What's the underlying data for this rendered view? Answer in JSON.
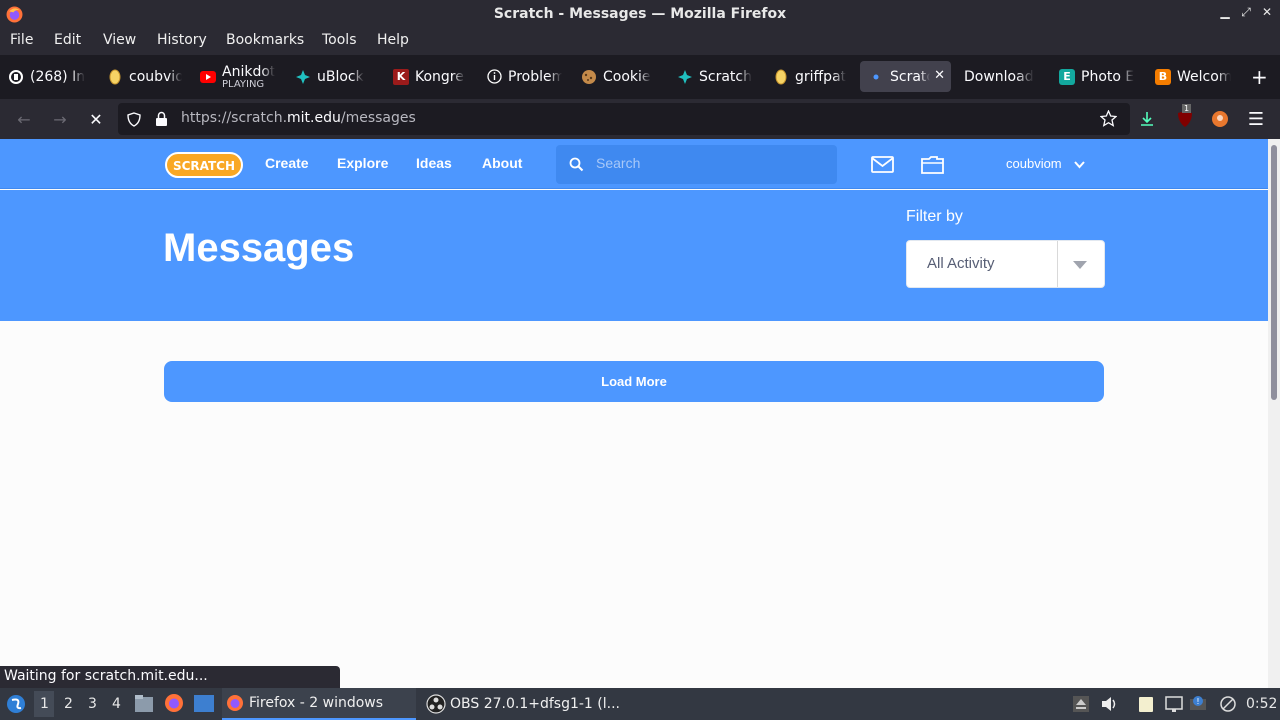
{
  "window": {
    "title": "Scratch - Messages — Mozilla Firefox",
    "controls": {
      "minimize": "▁",
      "maximize": "⤢",
      "close": "✕"
    }
  },
  "menu": [
    "File",
    "Edit",
    "View",
    "History",
    "Bookmarks",
    "Tools",
    "Help"
  ],
  "tabs": [
    {
      "label": "(268) In",
      "icon": "tab-favicon-circle"
    },
    {
      "label": "coubvio",
      "icon": "tab-favicon-coin"
    },
    {
      "label": "Anikdot",
      "sub": "PLAYING",
      "icon": "youtube-icon"
    },
    {
      "label": "uBlock",
      "icon": "scratch-addons-icon"
    },
    {
      "label": "Kongreg",
      "icon": "kongregate-icon"
    },
    {
      "label": "Problem",
      "icon": "info-icon"
    },
    {
      "label": "Cookie",
      "icon": "cookie-icon"
    },
    {
      "label": "Scratch",
      "icon": "scratch-addons-icon"
    },
    {
      "label": "griffpat",
      "icon": "tab-favicon-coin"
    },
    {
      "label": "Scratc",
      "icon": "loading-dot-icon",
      "active": true
    },
    {
      "label": "Download"
    },
    {
      "label": "Photo E",
      "icon": "photo-editor-icon"
    },
    {
      "label": "Welcom",
      "icon": "blogger-icon"
    }
  ],
  "new_tab": "+",
  "url": {
    "prefix": "https://scratch.",
    "domain": "mit.edu",
    "path": "/messages"
  },
  "toolbar_badge": "1",
  "scratch_nav": {
    "logo": "SCRATCH",
    "links": [
      "Create",
      "Explore",
      "Ideas",
      "About"
    ],
    "search_placeholder": "Search",
    "username": "coubviom"
  },
  "banner": {
    "title": "Messages",
    "filter_label": "Filter by",
    "filter_value": "All Activity"
  },
  "load_more": "Load More",
  "status_text": "Waiting for scratch.mit.edu...",
  "taskbar": {
    "workspaces": [
      "1",
      "2",
      "3",
      "4"
    ],
    "tasks": [
      {
        "label": "Firefox - 2 windows",
        "active": true
      },
      {
        "label": "OBS 27.0.1+dfsg1-1 (l..."
      }
    ],
    "clock": "0:52"
  },
  "colors": {
    "scratch_blue": "#4d97ff",
    "chrome_dark": "#2b2a33",
    "tab_strip": "#1c1b22"
  }
}
